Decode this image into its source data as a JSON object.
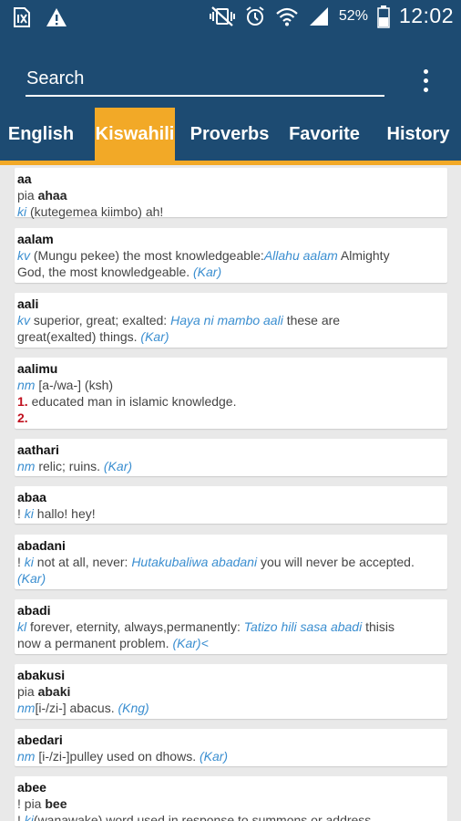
{
  "status_bar": {
    "battery_percent": "52%",
    "time": "12:02",
    "icons": [
      "sim-info-icon",
      "warning-icon",
      "vibrate-mute-icon",
      "alarm-icon",
      "wifi-icon",
      "signal-icon",
      "battery-icon"
    ]
  },
  "search": {
    "placeholder": "Search"
  },
  "tabs": [
    {
      "label": "English"
    },
    {
      "label": "Kiswahili"
    },
    {
      "label": "Proverbs"
    },
    {
      "label": "Favorite"
    },
    {
      "label": "History"
    }
  ],
  "active_tab": "Kiswahili",
  "colors": {
    "primary": "#1d4b72",
    "accent": "#f2a927",
    "link": "#3a8ed0",
    "number": "#c0111f"
  },
  "entries": [
    {
      "headword": "aa",
      "l1": {
        "prefix": "pia ",
        "bold": "ahaa"
      },
      "l2": {
        "pos": "ki",
        "text": " (kutegemea kiimbo) ah!"
      }
    },
    {
      "headword": "aalam",
      "l1": {
        "pos": "kv",
        "text": " (Mungu pekee) the most knowledgeable:",
        "ex": "Allahu aalam",
        "after": " Almighty"
      },
      "l2": {
        "text": "God, the most knowledgeable. ",
        "src": "(Kar)"
      }
    },
    {
      "headword": "aali",
      "l1": {
        "pos": "kv",
        "text": " superior, great; exalted: ",
        "ex": "Haya ni mambo aali",
        "after": " these are"
      },
      "l2": {
        "text": "great(exalted) things. ",
        "src": "(Kar)"
      }
    },
    {
      "headword": "aalimu",
      "l1": {
        "pos": "nm",
        "text": " [a-/wa-] (ksh)"
      },
      "l2": {
        "num": "1.",
        "text": " educated man in islamic knowledge."
      },
      "l3": {
        "num": "2."
      }
    },
    {
      "headword": "aathari",
      "l1": {
        "pos": "nm",
        "text": " relic; ruins. ",
        "src": "(Kar)"
      }
    },
    {
      "headword": "abaa",
      "l1": {
        "prefix": "! ",
        "pos": "ki",
        "text": " hallo! hey!"
      }
    },
    {
      "headword": "abadani",
      "l1": {
        "prefix": "! ",
        "pos": "ki",
        "text": " not at all, never: ",
        "ex": "Hutakubaliwa abadani",
        "after": " you will never be accepted."
      },
      "l2": {
        "src": "(Kar)"
      }
    },
    {
      "headword": "abadi",
      "l1": {
        "pos": "kl",
        "text": " forever, eternity, always,permanently: ",
        "ex": "Tatizo hili sasa abadi",
        "after": " thisis"
      },
      "l2": {
        "text": "now a permanent problem. ",
        "src": "(Kar)",
        "after": "<"
      }
    },
    {
      "headword": "abakusi",
      "l1": {
        "prefix": "pia ",
        "bold": "abaki"
      },
      "l2": {
        "pos": "nm",
        "text": "[i-/zi-] abacus. ",
        "src": "(Kng)"
      }
    },
    {
      "headword": "abedari",
      "l1": {
        "pos": "nm",
        "text": " [i-/zi-]pulley used on dhows. ",
        "src": "(Kar)"
      }
    },
    {
      "headword": "abee",
      "l1": {
        "prefix": "! pia ",
        "bold": "bee"
      },
      "l2": {
        "prefix": "! ",
        "pos": "ki",
        "text": "(wanawake) word used in response to summons or address."
      }
    }
  ]
}
